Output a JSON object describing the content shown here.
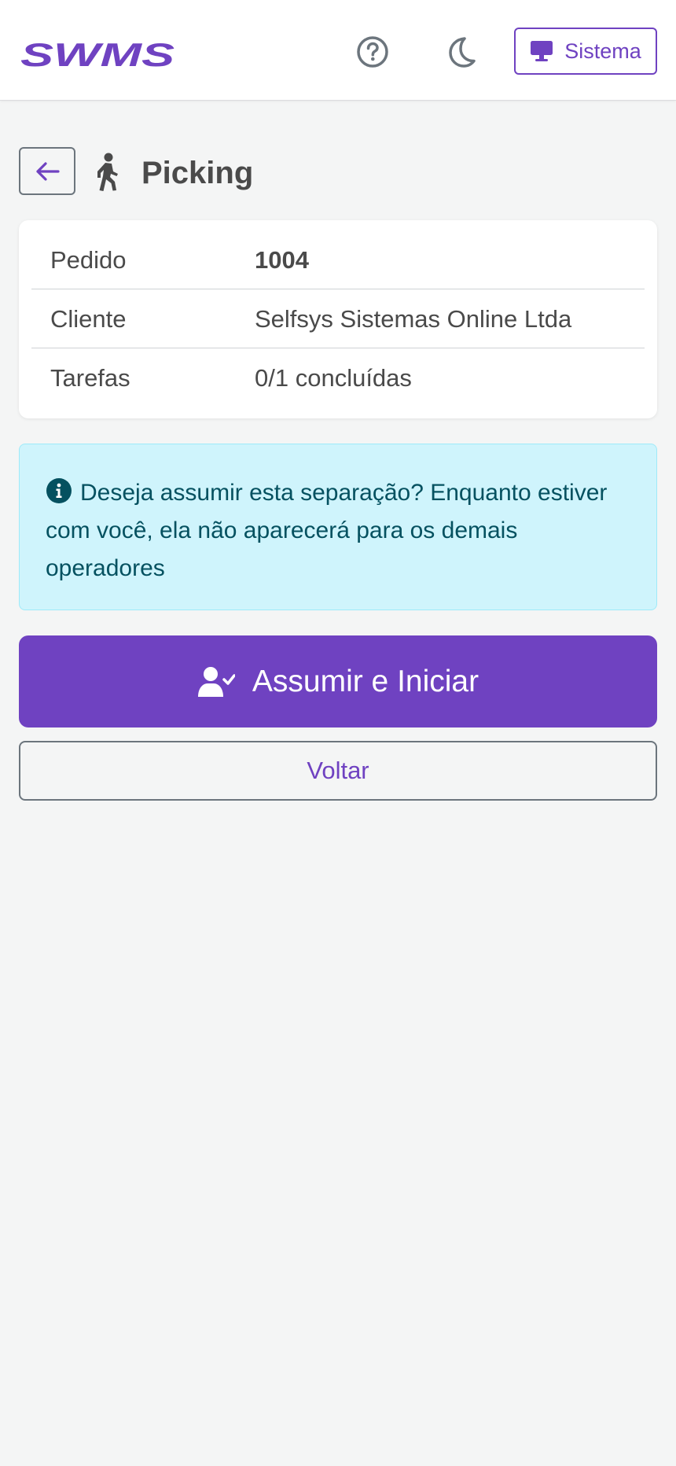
{
  "header": {
    "logo_text": "SWMS",
    "help_icon": "question-circle-icon",
    "theme_icon": "moon-icon",
    "system_button": {
      "icon": "monitor-icon",
      "label": "Sistema"
    }
  },
  "page": {
    "back_icon": "arrow-left-icon",
    "title_icon": "person-walking-icon",
    "title": "Picking"
  },
  "details": [
    {
      "label": "Pedido",
      "value": "1004"
    },
    {
      "label": "Cliente",
      "value": "Selfsys Sistemas Online Ltda"
    },
    {
      "label": "Tarefas",
      "value": "0/1 concluídas"
    }
  ],
  "alert": {
    "icon": "info-circle-icon",
    "text": "Deseja assumir esta separação? Enquanto estiver com você, ela não aparecerá para os demais operadores"
  },
  "actions": {
    "primary": {
      "icon": "user-check-icon",
      "label": "Assumir e Iniciar"
    },
    "secondary": {
      "label": "Voltar"
    }
  },
  "colors": {
    "brand": "#6f42c1",
    "alert_bg": "#cff4fc",
    "alert_text": "#055160",
    "background": "#f4f5f5"
  }
}
